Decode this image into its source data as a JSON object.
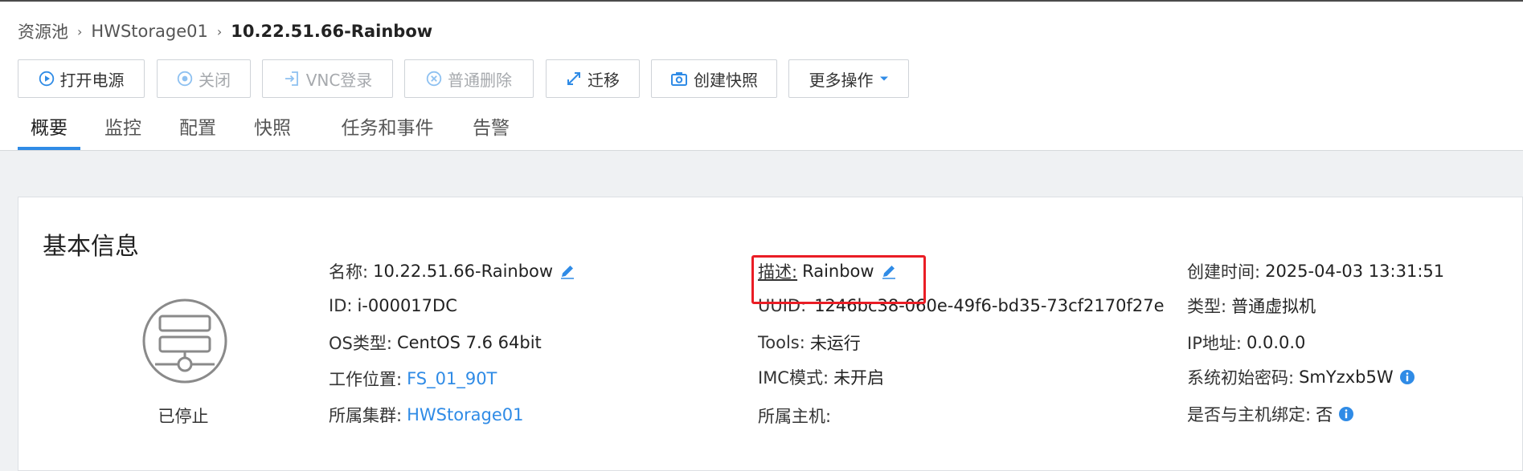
{
  "breadcrumb": {
    "items": [
      "资源池",
      "HWStorage01"
    ],
    "current": "10.22.51.66-Rainbow"
  },
  "toolbar": {
    "power_on": "打开电源",
    "shutdown": "关闭",
    "vnc_login": "VNC登录",
    "normal_delete": "普通删除",
    "migrate": "迁移",
    "create_snapshot": "创建快照",
    "more_actions": "更多操作"
  },
  "tabs": [
    "概要",
    "监控",
    "配置",
    "快照",
    "任务和事件",
    "告警"
  ],
  "card": {
    "title": "基本信息",
    "status": "已停止"
  },
  "info": {
    "name_label": "名称:",
    "name_value": "10.22.51.66-Rainbow",
    "id_label": "ID:",
    "id_value": "i-000017DC",
    "os_label": "OS类型:",
    "os_value": "CentOS 7.6 64bit",
    "work_location_label": "工作位置:",
    "work_location_value": "FS_01_90T",
    "cluster_label": "所属集群:",
    "cluster_value": "HWStorage01",
    "desc_label": "描述:",
    "desc_value": "Rainbow",
    "uuid_label": "UUID:",
    "uuid_value": "1246bc38-060e-49f6-bd35-73cf2170f27e",
    "tools_label": "Tools:",
    "tools_value": "未运行",
    "imc_label": "IMC模式:",
    "imc_value": "未开启",
    "host_label": "所属主机:",
    "host_value": "",
    "created_label": "创建时间:",
    "created_value": "2025-04-03 13:31:51",
    "type_label": "类型:",
    "type_value": "普通虚拟机",
    "ip_label": "IP地址:",
    "ip_value": "0.0.0.0",
    "init_pwd_label": "系统初始密码:",
    "init_pwd_value": "SmYzxb5W",
    "bind_label": "是否与主机绑定:",
    "bind_value": "否"
  },
  "colors": {
    "accent": "#2f8be6",
    "highlight": "#ea1d25",
    "disabled": "#a6a9ad",
    "background_gray": "#eff1f3"
  },
  "icons": {
    "power_on": "play-circle-icon",
    "shutdown": "stop-circle-icon",
    "vnc": "login-icon",
    "delete": "x-circle-icon",
    "migrate": "expand-arrows-icon",
    "snapshot": "camera-icon",
    "more": "caret-down-icon",
    "edit": "pencil-icon",
    "info": "info-icon",
    "vm": "vm-server-icon"
  }
}
